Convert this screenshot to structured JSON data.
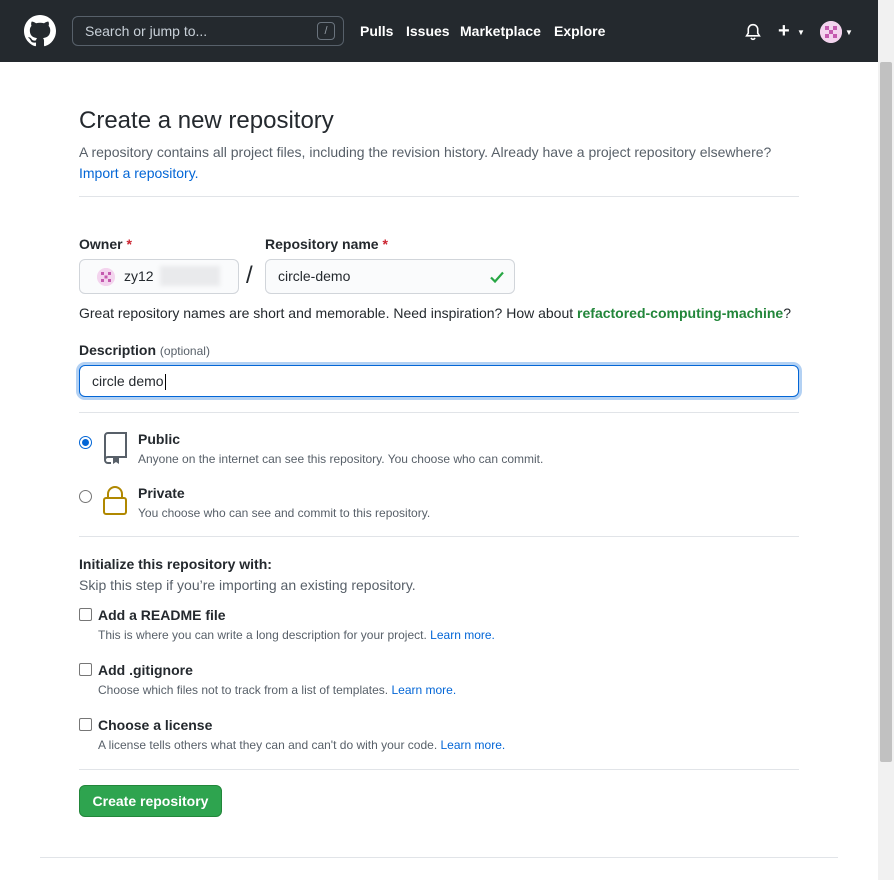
{
  "header": {
    "search_placeholder": "Search or jump to...",
    "search_shortcut": "/",
    "nav": [
      "Pulls",
      "Issues",
      "Marketplace",
      "Explore"
    ],
    "plus_label": "+"
  },
  "page": {
    "title": "Create a new repository",
    "subtitle": "A repository contains all project files, including the revision history. Already have a project repository elsewhere?",
    "import_link": "Import a repository."
  },
  "form": {
    "owner_label": "Owner",
    "owner_value": "zy12",
    "repo_label": "Repository name",
    "required_mark": "*",
    "separator": "/",
    "repo_value": "circle-demo",
    "hint_prefix": "Great repository names are short and memorable. Need inspiration? How about ",
    "hint_suggestion": "refactored-computing-machine",
    "hint_suffix": "?",
    "description_label": "Description",
    "description_optional": "(optional)",
    "description_value": "circle demo"
  },
  "visibility": {
    "public_title": "Public",
    "public_desc": "Anyone on the internet can see this repository. You choose who can commit.",
    "private_title": "Private",
    "private_desc": "You choose who can see and commit to this repository.",
    "selected": "public"
  },
  "init": {
    "title": "Initialize this repository with:",
    "subtitle": "Skip this step if you’re importing an existing repository.",
    "readme_title": "Add a README file",
    "readme_desc": "This is where you can write a long description for your project.",
    "gitignore_title": "Add .gitignore",
    "gitignore_desc": "Choose which files not to track from a list of templates.",
    "license_title": "Choose a license",
    "license_desc": "A license tells others what they can and can't do with your code.",
    "learn_more": "Learn more."
  },
  "submit_label": "Create repository",
  "colors": {
    "header_bg": "#24292e",
    "primary_button": "#2ea44f",
    "link": "#0366d6",
    "suggestion": "#22863a"
  }
}
